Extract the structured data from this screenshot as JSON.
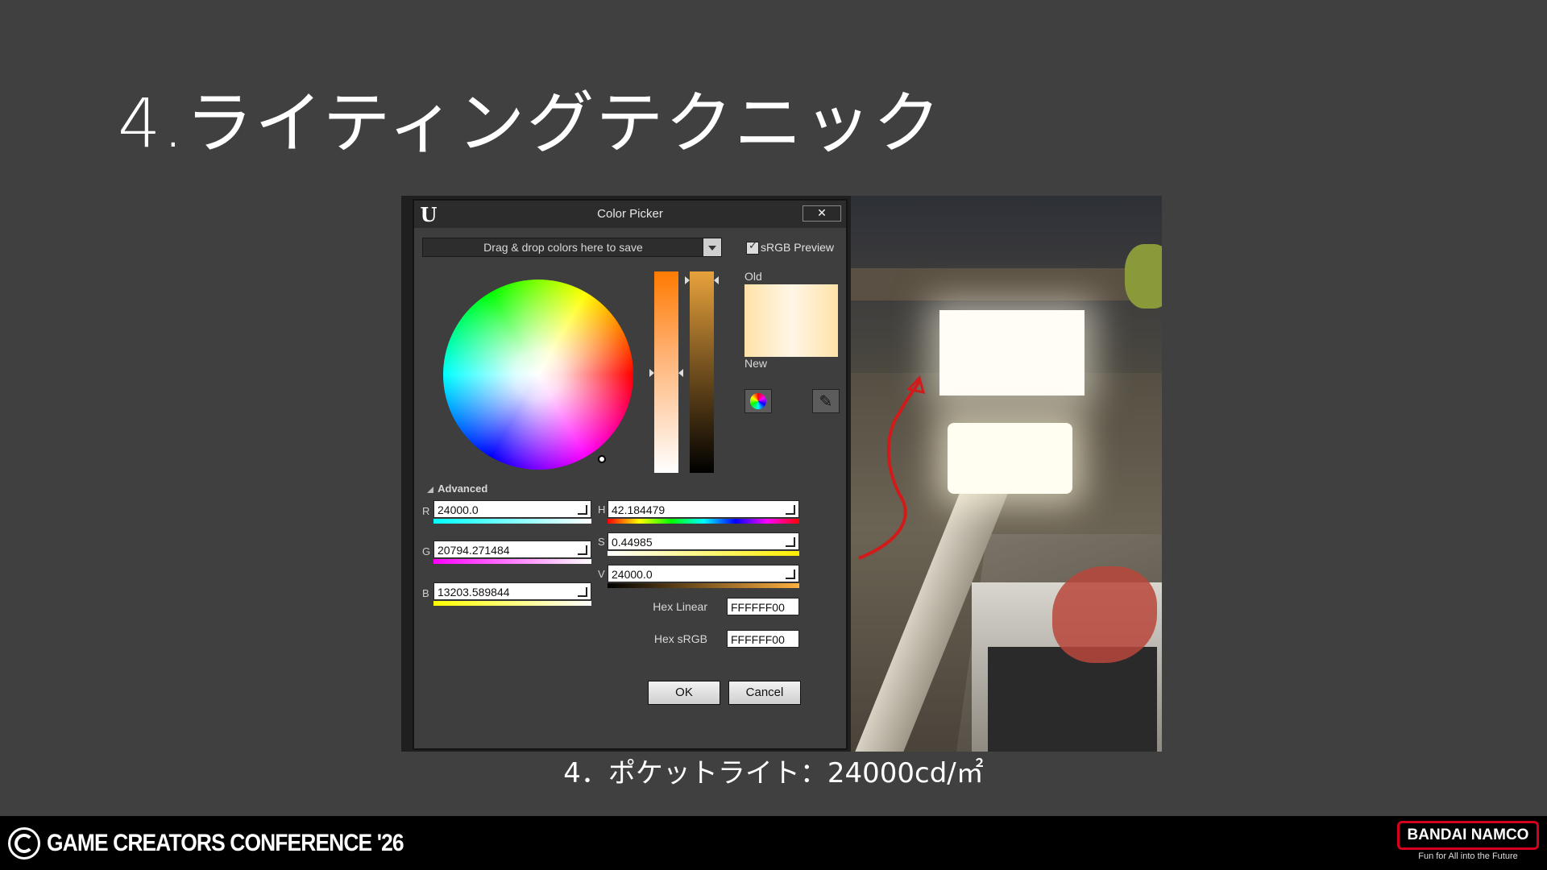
{
  "slide": {
    "title": "4.ライティングテクニック",
    "caption": "4．ポケットライト：24000cd/㎡"
  },
  "color_picker": {
    "window_title": "Color Picker",
    "logo": "U",
    "close_label": "✕",
    "save_area_text": "Drag & drop colors here to save",
    "srgb_preview_label": "sRGB Preview",
    "srgb_preview_checked": true,
    "old_label": "Old",
    "new_label": "New",
    "advanced_label": "Advanced",
    "channels": {
      "r_label": "R",
      "r_value": "24000.0",
      "g_label": "G",
      "g_value": "20794.271484",
      "b_label": "B",
      "b_value": "13203.589844",
      "h_label": "H",
      "h_value": "42.184479",
      "s_label": "S",
      "s_value": "0.44985",
      "v_label": "V",
      "v_value": "24000.0"
    },
    "hex_linear_label": "Hex Linear",
    "hex_linear_value": "FFFFFF00",
    "hex_srgb_label": "Hex sRGB",
    "hex_srgb_value": "FFFFFF00",
    "ok_label": "OK",
    "cancel_label": "Cancel",
    "colors": {
      "old_swatch": "#fff1d6",
      "new_swatch": "#ffe2a8",
      "accent_orange": "#ff7a00"
    }
  },
  "footer": {
    "conference_name": "GAME CREATORS CONFERENCE '26",
    "brand_name": "BANDAI NAMCO",
    "brand_tagline": "Fun for All into the Future",
    "brand_color": "#d4001c"
  },
  "icons": [
    "ue-logo-icon",
    "close-icon",
    "chevron-down-icon",
    "checkbox-icon",
    "color-wheel-icon",
    "eyedropper-icon",
    "expand-icon",
    "triangle-down-icon"
  ]
}
